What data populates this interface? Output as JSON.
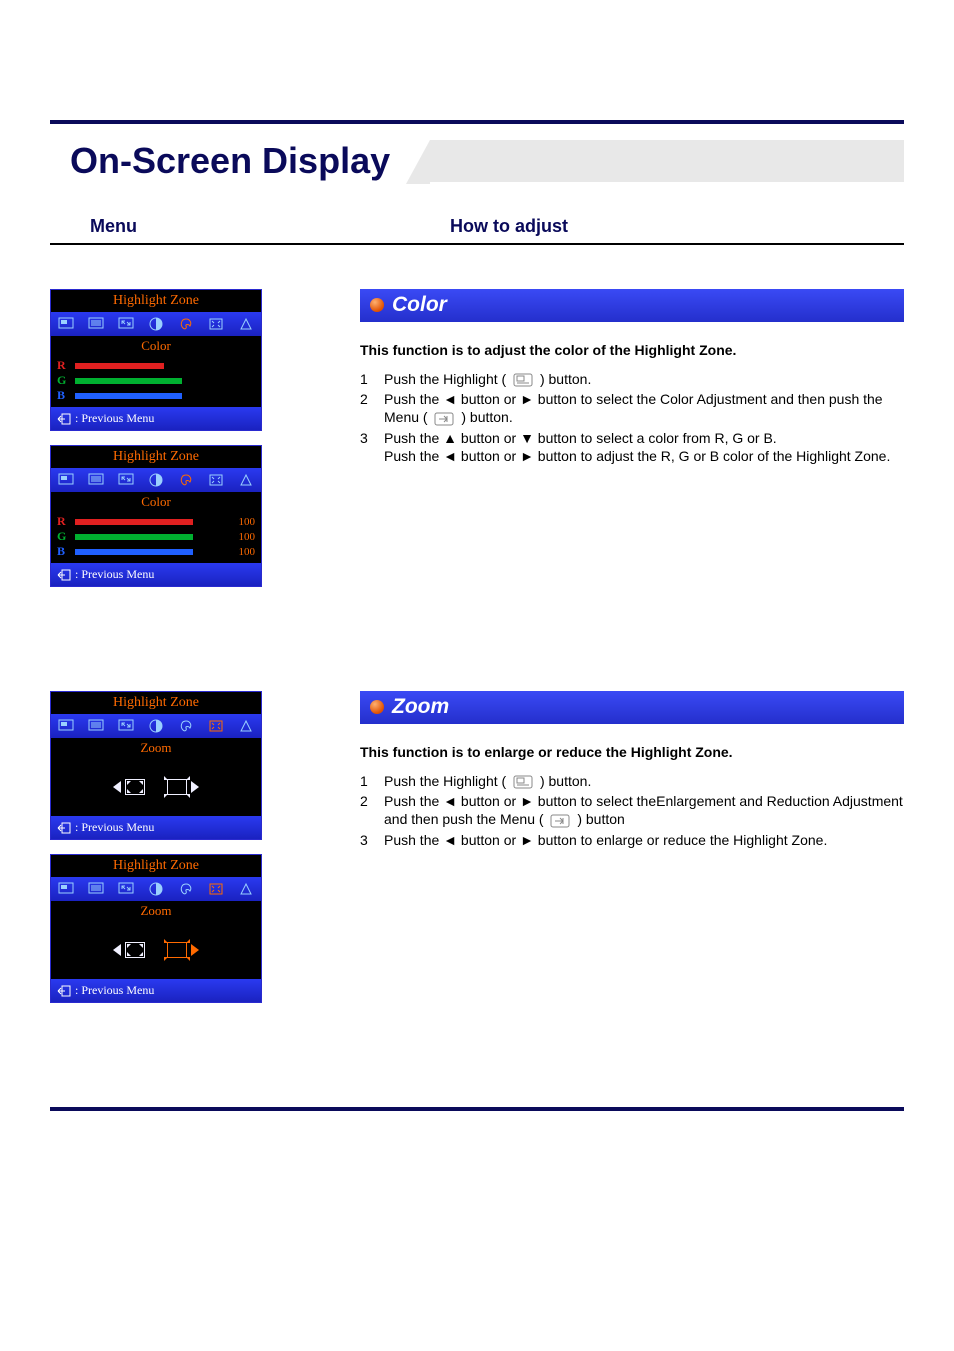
{
  "page_title": "On-Screen Display",
  "subhead": {
    "menu": "Menu",
    "howto": "How to adjust"
  },
  "osd": {
    "title": "Highlight Zone",
    "prev": ": Previous Menu",
    "color_label": "Color",
    "zoom_label": "Zoom",
    "rgb_labels": {
      "r": "R",
      "g": "G",
      "b": "B"
    },
    "rgb_values": {
      "r": "100",
      "g": "100",
      "b": "100"
    },
    "color1": {
      "r_pct": 60,
      "g_pct": 72,
      "b_pct": 72
    },
    "color2": {
      "r_pct": 80,
      "g_pct": 80,
      "b_pct": 80
    }
  },
  "sections": {
    "color": {
      "heading": "Color",
      "intro": "This function is to adjust the color of the Highlight Zone.",
      "steps": {
        "s1": "Push the Highlight (",
        "s1b": ") button.",
        "s2a": "Push the ",
        "s2b": " button or ",
        "s2c": " button to select the Color Adjustment and then push the Menu (",
        "s2d": ") button.",
        "s3a": "Push the ",
        "s3b": " button or ",
        "s3c": " button to select a color from R, G or B.",
        "s3d": "Push the ",
        "s3e": " button or ",
        "s3f": " button to adjust the R, G or B color of the Highlight Zone."
      }
    },
    "zoom": {
      "heading": "Zoom",
      "intro": "This function is to enlarge or reduce the Highlight Zone.",
      "steps": {
        "s1": "Push the Highlight (",
        "s1b": ") button.",
        "s2a": "Push the ",
        "s2b": " button or ",
        "s2c": " button to select theEnlargement and Reduction Adjustment and then push the Menu (",
        "s2d": ") button",
        "s3a": "Push the ",
        "s3b": " button or ",
        "s3c": " button to enlarge or reduce the Highlight Zone."
      }
    }
  },
  "nums": {
    "n1": "1",
    "n2": "2",
    "n3": "3"
  },
  "arrows": {
    "left": "◄",
    "right": "►",
    "up": "▲",
    "down": "▼"
  }
}
